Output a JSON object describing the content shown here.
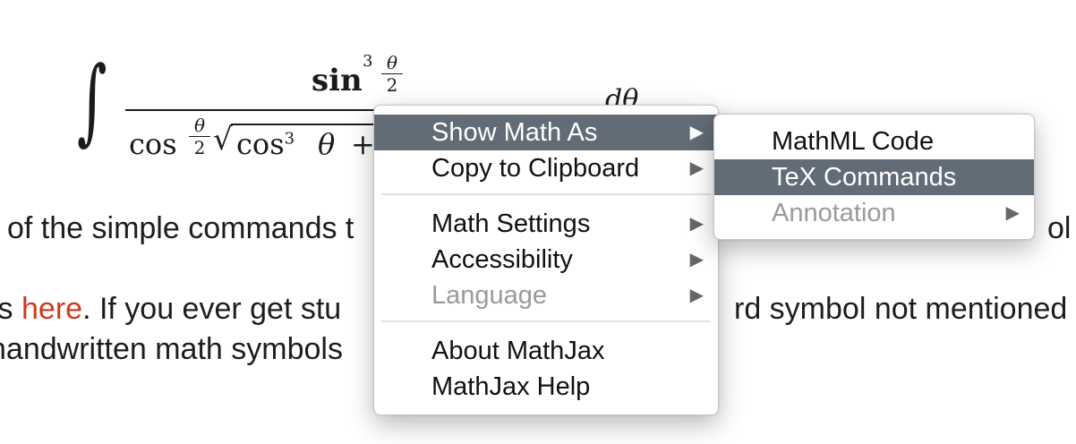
{
  "math": {
    "integral": "∫",
    "numerator_fn": "sin",
    "numerator_exp": "3",
    "numerator_frac_num": "θ",
    "numerator_frac_den": "2",
    "d_theta": "dθ",
    "denominator_fn": "cos",
    "denominator_frac_num": "θ",
    "denominator_frac_den": "2",
    "sqrt": "√",
    "cos_term": "cos",
    "cos_term_exp": "3",
    "theta": "θ",
    "plus": "+"
  },
  "paragraph": {
    "line1_left": "of the simple commands t",
    "line1_right": "ol",
    "line2_left_pre": "ls ",
    "line2_link": "here",
    "line2_left_post": ". If you ever get stu",
    "line2_right": "rd symbol not mentioned",
    "line3_left": "handwritten math symbols"
  },
  "context_menu": {
    "items": [
      {
        "label": "Show Math As",
        "arrow": "▶"
      },
      {
        "label": "Copy to Clipboard",
        "arrow": "▶"
      },
      {
        "label": "Math Settings",
        "arrow": "▶"
      },
      {
        "label": "Accessibility",
        "arrow": "▶"
      },
      {
        "label": "Language",
        "arrow": "▶"
      },
      {
        "label": "About MathJax"
      },
      {
        "label": "MathJax Help"
      }
    ]
  },
  "submenu": {
    "items": [
      {
        "label": "MathML Code"
      },
      {
        "label": "TeX Commands"
      },
      {
        "label": "Annotation",
        "arrow": "▶"
      }
    ]
  },
  "colors": {
    "menu_highlight": "#626c76",
    "link": "#d2381f",
    "disabled_text": "#9a9a9a"
  }
}
